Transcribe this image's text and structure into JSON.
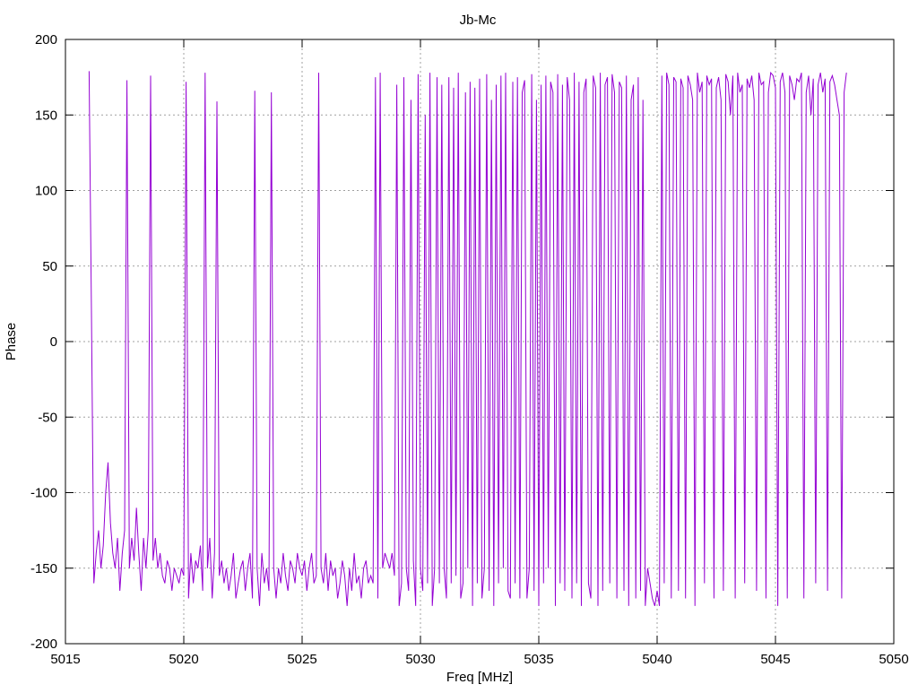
{
  "chart_data": {
    "type": "line",
    "title": "Jb-Mc",
    "xlabel": "Freq [MHz]",
    "ylabel": "Phase",
    "xlim": [
      5015,
      5050
    ],
    "ylim": [
      -200,
      200
    ],
    "xticks": [
      5015,
      5020,
      5025,
      5030,
      5035,
      5040,
      5045,
      5050
    ],
    "yticks": [
      -200,
      -150,
      -100,
      -50,
      0,
      50,
      100,
      150,
      200
    ],
    "xtick_labels": [
      "5015",
      "5020",
      "5025",
      "5030",
      "5035",
      "5040",
      "5045",
      "5050"
    ],
    "ytick_labels": [
      "-200",
      "-150",
      "-100",
      "-50",
      "0",
      "50",
      "100",
      "150",
      "200"
    ],
    "grid": true,
    "legend": "none",
    "series": [
      {
        "name": "Jb-Mc",
        "color": "#9400d3",
        "x_start": 5016.0,
        "x_step": 0.1,
        "values": [
          179,
          20,
          -160,
          -140,
          -125,
          -150,
          -135,
          -100,
          -80,
          -120,
          -140,
          -150,
          -130,
          -165,
          -140,
          -125,
          173,
          -150,
          -130,
          -145,
          -110,
          -140,
          -165,
          -130,
          -150,
          -125,
          176,
          -145,
          -130,
          -150,
          -140,
          -155,
          -160,
          -145,
          -150,
          -165,
          -150,
          -155,
          -160,
          -150,
          -155,
          172,
          -170,
          -140,
          -160,
          -145,
          -150,
          -135,
          -165,
          178,
          -150,
          -130,
          -170,
          -140,
          159,
          -155,
          -145,
          -160,
          -150,
          -165,
          -155,
          -140,
          -170,
          -160,
          -150,
          -145,
          -165,
          -150,
          -140,
          -170,
          166,
          -150,
          -175,
          -140,
          -160,
          -150,
          -165,
          165,
          -150,
          -170,
          -150,
          -160,
          -140,
          -155,
          -165,
          -145,
          -150,
          -160,
          -140,
          -150,
          -155,
          -145,
          -165,
          -150,
          -140,
          -160,
          -155,
          178,
          -150,
          -160,
          -140,
          -165,
          -145,
          -155,
          -150,
          -170,
          -160,
          -145,
          -155,
          -175,
          -150,
          -165,
          -140,
          -160,
          -155,
          -170,
          -150,
          -145,
          -160,
          -155,
          -160,
          175,
          -170,
          178,
          -150,
          -140,
          -145,
          -150,
          -140,
          -155,
          170,
          -175,
          -160,
          175,
          -150,
          -165,
          160,
          -145,
          -175,
          177,
          -150,
          -165,
          150,
          -160,
          178,
          -175,
          -150,
          175,
          -160,
          170,
          -150,
          -170,
          175,
          -160,
          168,
          -155,
          178,
          -170,
          -160,
          165,
          -150,
          172,
          -175,
          168,
          -160,
          174,
          -170,
          -150,
          177,
          -165,
          160,
          -175,
          170,
          -160,
          176,
          -150,
          178,
          -165,
          -170,
          172,
          -160,
          175,
          -170,
          165,
          173,
          -170,
          -150,
          177,
          -165,
          160,
          -175,
          170,
          -160,
          176,
          -150,
          172,
          165,
          -175,
          177,
          -160,
          170,
          -165,
          175,
          160,
          -170,
          178,
          -160,
          172,
          -175,
          165,
          174,
          -160,
          -170,
          176,
          168,
          -175,
          178,
          -165,
          170,
          175,
          -160,
          177,
          165,
          -170,
          172,
          168,
          -165,
          176,
          -175,
          160,
          170,
          -170,
          175,
          -165,
          160,
          -175,
          -150,
          -160,
          -170,
          -175,
          -165,
          -175,
          176,
          -160,
          178,
          170,
          -170,
          175,
          172,
          -165,
          174,
          168,
          -170,
          176,
          170,
          160,
          -175,
          178,
          165,
          172,
          -160,
          176,
          170,
          174,
          -170,
          168,
          175,
          160,
          -165,
          177,
          172,
          150,
          176,
          -170,
          178,
          165,
          170,
          -160,
          174,
          168,
          176,
          160,
          -165,
          178,
          170,
          172,
          -170,
          165,
          178,
          176,
          168,
          -175,
          172,
          178,
          165,
          -170,
          176,
          170,
          160,
          174,
          172,
          178,
          -170,
          165,
          176,
          150,
          174,
          -160,
          170,
          178,
          165,
          174,
          -165,
          172,
          176,
          170,
          160,
          150,
          -170,
          165,
          178
        ]
      }
    ]
  }
}
